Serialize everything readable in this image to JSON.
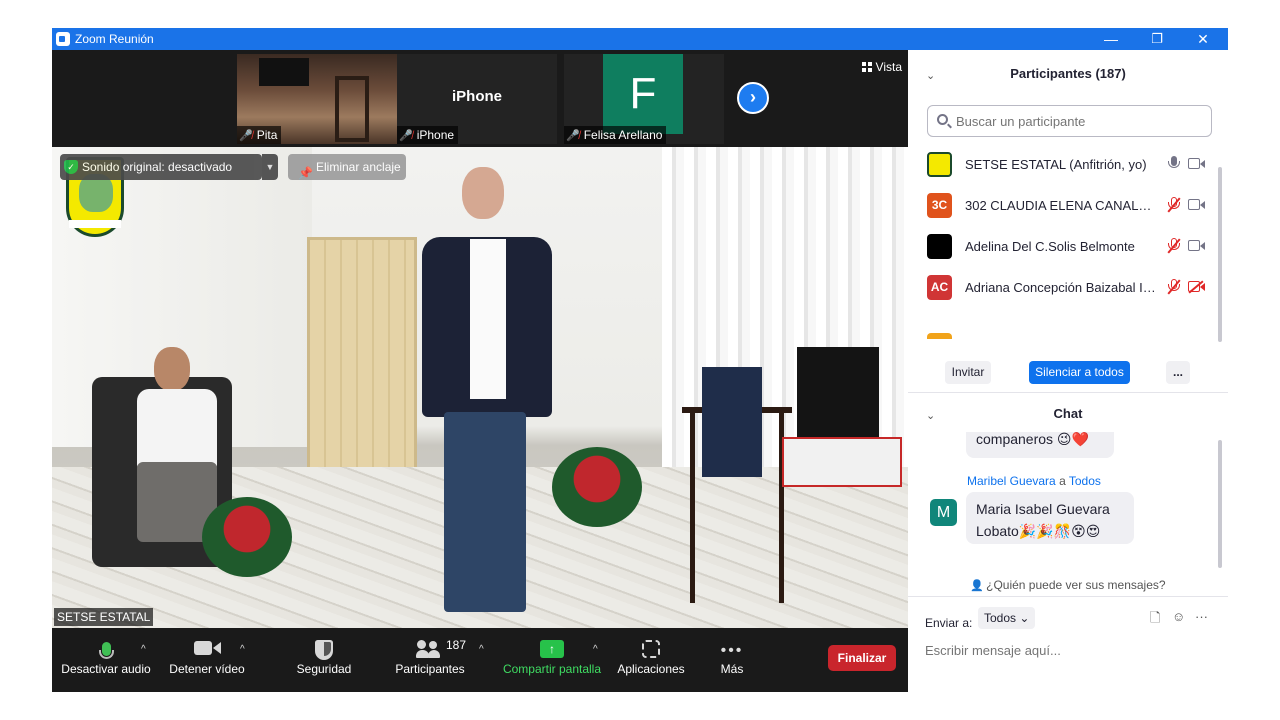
{
  "window": {
    "title": "Zoom Reunión",
    "minimize_glyph": "—",
    "restore_glyph": "❐",
    "close_glyph": "✕"
  },
  "gallery": {
    "thumbnails": [
      {
        "name": "Pita",
        "muted": true
      },
      {
        "name": "iPhone",
        "label": "iPhone",
        "muted": true
      },
      {
        "name": "Felisa Arellano",
        "letter": "F",
        "tile_color": "#0f7e5f",
        "muted": true
      }
    ],
    "next_glyph": "›",
    "view_label": "Vista"
  },
  "main_video": {
    "original_sound_label": "Sonido original: desactivado",
    "unpin_label": "Eliminar anclaje",
    "active_speaker_name": "SETSE ESTATAL"
  },
  "toolbar": {
    "audio_label": "Desactivar audio",
    "video_label": "Detener vídeo",
    "security_label": "Seguridad",
    "participants_label": "Participantes",
    "participants_count": "187",
    "share_label": "Compartir pantalla",
    "apps_label": "Aplicaciones",
    "more_label": "Más",
    "more_glyph": "•••",
    "end_label": "Finalizar",
    "caret_glyph": "^"
  },
  "participants_panel": {
    "title": "Participantes (187)",
    "search_placeholder": "Buscar un participante",
    "list": [
      {
        "avatar": "",
        "avatar_color": "#f4e900",
        "name": "SETSE ESTATAL (Anfitrión, yo)",
        "mic_muted": false,
        "video_off": false
      },
      {
        "avatar": "3C",
        "avatar_color": "#e0531c",
        "name": "302 CLAUDIA ELENA CANALES ...",
        "mic_muted": true,
        "video_off": false
      },
      {
        "avatar": "",
        "avatar_color": "#000000",
        "name": "Adelina Del C.Solis Belmonte",
        "mic_muted": true,
        "video_off": false
      },
      {
        "avatar": "AC",
        "avatar_color": "#d03535",
        "name": "Adriana Concepción Baizabal Ib...",
        "mic_muted": true,
        "video_off": true
      }
    ],
    "invite_label": "Invitar",
    "mute_all_label": "Silenciar a todos",
    "more_label": "..."
  },
  "chat_panel": {
    "title": "Chat",
    "previous_message": "companeros 😉❤️",
    "sender": "Maribel Guevara",
    "to_word": "a",
    "recipient": "Todos",
    "sender_avatar": "M",
    "message": "Maria Isabel Guevara Lobato🎉🎉🎊😵😍",
    "who_can_see": "¿Quién puede ver sus mensajes?",
    "send_to_label": "Enviar a:",
    "send_to_value": "Todos",
    "input_placeholder": "Escribir mensaje aquí..."
  },
  "colors": {
    "titlebar": "#1a73e8",
    "accent_blue": "#0e72ed",
    "end_red": "#c9252c",
    "share_green": "#27c24a"
  }
}
